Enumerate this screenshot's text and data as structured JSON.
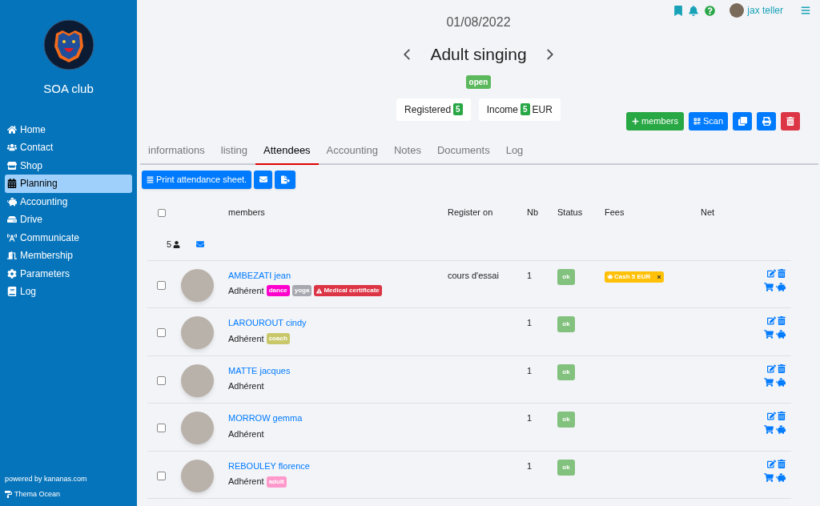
{
  "sidebar": {
    "club_name": "SOA club",
    "items": [
      {
        "label": "Home",
        "selected": false
      },
      {
        "label": "Contact",
        "selected": false
      },
      {
        "label": "Shop",
        "selected": false
      },
      {
        "label": "Planning",
        "selected": true
      },
      {
        "label": "Accounting",
        "selected": false
      },
      {
        "label": "Drive",
        "selected": false
      },
      {
        "label": "Communicate",
        "selected": false
      },
      {
        "label": "Membership",
        "selected": false
      },
      {
        "label": "Parameters",
        "selected": false
      },
      {
        "label": "Log",
        "selected": false
      }
    ],
    "footer": {
      "powered_by": "powered by kananas.com",
      "theme": "Thema Ocean"
    }
  },
  "topbar": {
    "user_name": "jax teller"
  },
  "event": {
    "date": "01/08/2022",
    "title": "Adult singing",
    "status": "open",
    "stats": [
      {
        "label": "Registered",
        "count": "5"
      },
      {
        "label": "Income",
        "count": "5",
        "unit": "EUR"
      }
    ]
  },
  "actions": {
    "add_label": "members",
    "scan_label": "Scan"
  },
  "tabs": [
    {
      "label": "informations",
      "selected": false
    },
    {
      "label": "listing",
      "selected": false
    },
    {
      "label": "Attendees",
      "selected": true
    },
    {
      "label": "Accounting",
      "selected": false
    },
    {
      "label": "Notes",
      "selected": false
    },
    {
      "label": "Documents",
      "selected": false
    },
    {
      "label": "Log",
      "selected": false
    }
  ],
  "toolbar": {
    "print_label": "Print attendance sheet."
  },
  "table": {
    "columns": [
      "members",
      "Register on",
      "Nb",
      "Status",
      "Fees",
      "Net"
    ],
    "select_all_checked": false,
    "summary": {
      "count": "5"
    },
    "rows": [
      {
        "checked": false,
        "name": "AMBEZATI jean",
        "role": "Adhérent",
        "tags": [
          {
            "label": "dance",
            "color": "#ff00cc",
            "kind": "plain"
          },
          {
            "label": "yoga",
            "color": "#a8a8b0",
            "kind": "plain"
          },
          {
            "label": "Medical certificate",
            "color": "#dc3545",
            "kind": "alert"
          }
        ],
        "register_on": "cours d'essai",
        "nb": "1",
        "status": "ok",
        "fees": [
          {
            "label": "Cash 5 EUR"
          }
        ]
      },
      {
        "checked": false,
        "name": "LAROUROUT cindy",
        "role": "Adhérent",
        "tags": [
          {
            "label": "coach",
            "color": "#c8c86a",
            "kind": "plain"
          }
        ],
        "nb": "1",
        "status": "ok"
      },
      {
        "checked": false,
        "name": "MATTE jacques",
        "role": "Adhérent",
        "nb": "1",
        "status": "ok"
      },
      {
        "checked": false,
        "name": "MORROW gemma",
        "role": "Adhérent",
        "nb": "1",
        "status": "ok"
      },
      {
        "checked": false,
        "name": "REBOULEY florence",
        "role": "Adhérent",
        "tags": [
          {
            "label": "adult",
            "color": "#ff99cc",
            "kind": "plain"
          }
        ],
        "nb": "1",
        "status": "ok"
      }
    ]
  }
}
